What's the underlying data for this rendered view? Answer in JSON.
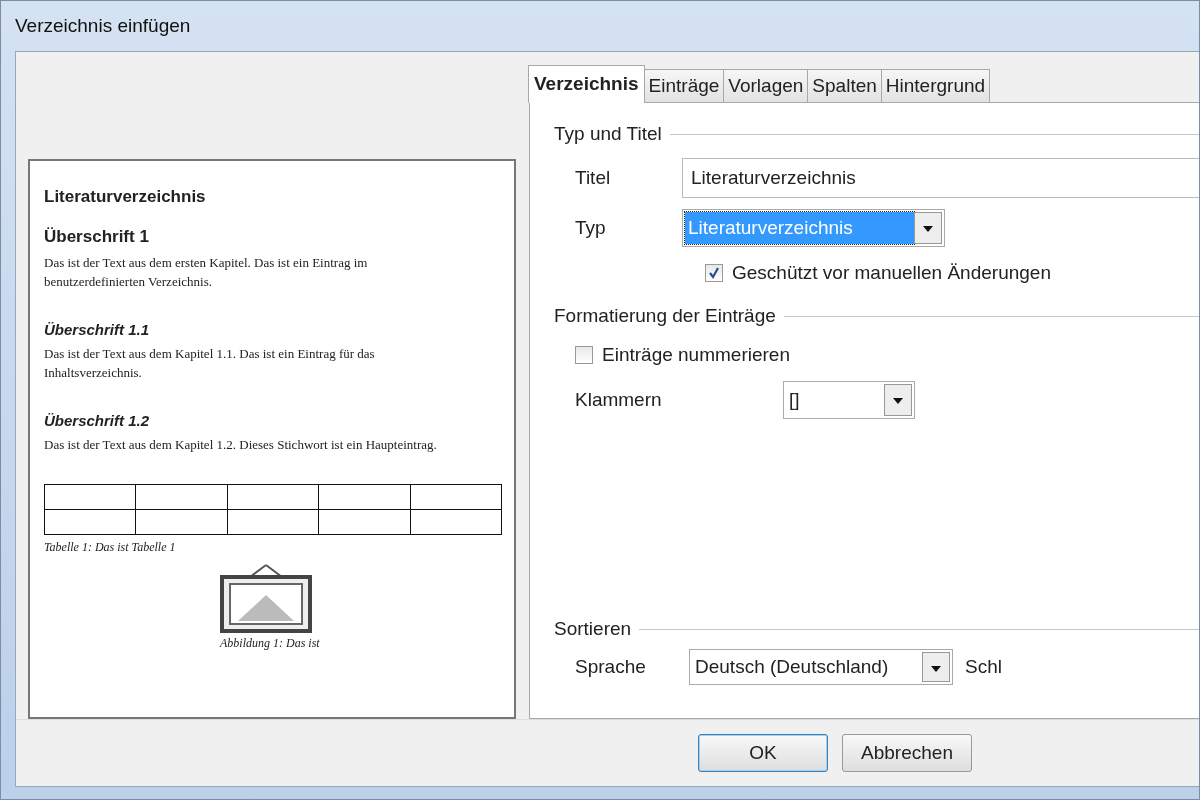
{
  "window": {
    "title": "Verzeichnis einfügen"
  },
  "preview": {
    "heading": "Literaturverzeichnis",
    "sections": [
      {
        "kind": "h1",
        "title": "Überschrift 1",
        "text": "Das ist der Text aus dem ersten Kapitel. Das ist ein Eintrag im benutzerdefinierten Verzeichnis."
      },
      {
        "kind": "h2",
        "title": "Überschrift 1.1",
        "text": "Das ist der Text aus dem Kapitel 1.1. Das ist ein Eintrag für das Inhaltsverzeichnis."
      },
      {
        "kind": "h2",
        "title": "Überschrift 1.2",
        "text": "Das ist der Text aus dem Kapitel 1.2. Dieses Stichwort ist ein Haupteintrag."
      }
    ],
    "table_caption": "Tabelle 1: Das ist Tabelle 1",
    "figure_caption": "Abbildung 1: Das ist"
  },
  "tabs": [
    {
      "label": "Verzeichnis",
      "selected": true
    },
    {
      "label": "Einträge",
      "selected": false
    },
    {
      "label": "Vorlagen",
      "selected": false
    },
    {
      "label": "Spalten",
      "selected": false
    },
    {
      "label": "Hintergrund",
      "selected": false
    }
  ],
  "type_and_title": {
    "heading": "Typ und Titel",
    "rows": [
      {
        "kind": "text",
        "label": "Titel",
        "value": "Literaturverzeichnis"
      },
      {
        "kind": "dropdown",
        "label": "Typ",
        "value": "Literaturverzeichnis",
        "focused": true
      },
      {
        "kind": "checkbox",
        "label": "Geschützt vor manuellen Änderungen",
        "checked": true
      }
    ]
  },
  "entry_format": {
    "heading": "Formatierung der Einträge",
    "rows": [
      {
        "kind": "checkbox",
        "label": "Einträge nummerieren",
        "checked": false
      },
      {
        "kind": "dropdown",
        "label": "Klammern",
        "value": "[]",
        "focused": false
      }
    ]
  },
  "sort": {
    "heading": "Sortieren",
    "language_label": "Sprache",
    "language_value": "Deutsch (Deutschland)",
    "key_label": "Schl"
  },
  "buttons": [
    {
      "label": "OK",
      "default": true
    },
    {
      "label": "Abbrechen",
      "default": false
    }
  ]
}
